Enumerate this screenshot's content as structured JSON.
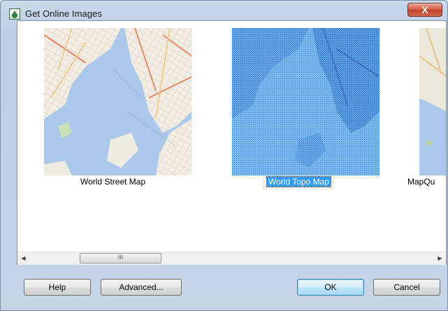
{
  "window": {
    "title": "Get Online Images",
    "close_glyph": "X"
  },
  "gallery": {
    "items": [
      {
        "label": "World Street Map",
        "selected": false
      },
      {
        "label": "World Topo Map",
        "selected": true
      },
      {
        "label": "MapQu",
        "selected": false
      }
    ]
  },
  "scrollbar": {
    "left_arrow": "◀",
    "right_arrow": "▶",
    "grip": "III"
  },
  "buttons": {
    "help": "Help",
    "advanced": "Advanced...",
    "ok": "OK",
    "cancel": "Cancel"
  },
  "colors": {
    "selection": "#3399ff",
    "water": "#a7c6e8",
    "land": "#efece2",
    "topo_tint": "#4aa3e6"
  }
}
